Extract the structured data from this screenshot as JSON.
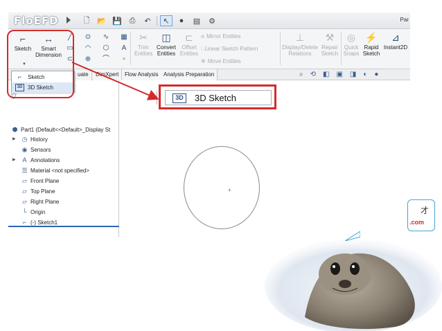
{
  "app": {
    "logo_text": "FloEFD",
    "title_fragment": "Par"
  },
  "ribbon": {
    "sketch_label": "Sketch",
    "smart_dimension_label": "Smart Dimension",
    "trim_entities_label": "Trim Entities",
    "convert_entities_label": "Convert Entities",
    "offset_entities_label": "Offset Entities",
    "mirror_entities_label": "Mirror Entities",
    "linear_sketch_pattern_label": "Linear Sketch Pattern",
    "move_entities_label": "Move Entities",
    "display_delete_relations_label": "Display/Delete Relations",
    "repair_sketch_label": "Repair Sketch",
    "quick_snaps_label": "Quick Snaps",
    "rapid_sketch_label": "Rapid Sketch",
    "instant2d_label": "Instant2D"
  },
  "tabs": [
    "uate",
    "DimXpert",
    "Flow Analysis",
    "Analysis Preparation"
  ],
  "sketch_menu": {
    "items": [
      {
        "label": "Sketch",
        "icon": "sketch-icon"
      },
      {
        "label": "3D Sketch",
        "icon": "3d-sketch-icon"
      }
    ]
  },
  "callout": {
    "icon_text": "3D",
    "label": "3D Sketch"
  },
  "tree": {
    "items": [
      {
        "label": "Part1  (Default<<Default>_Display St",
        "icon": "part-icon"
      },
      {
        "label": "History",
        "icon": "history-icon"
      },
      {
        "label": "Sensors",
        "icon": "sensors-icon"
      },
      {
        "label": "Annotations",
        "icon": "annotations-icon"
      },
      {
        "label": "Material <not specified>",
        "icon": "material-icon"
      },
      {
        "label": "Front Plane",
        "icon": "plane-icon"
      },
      {
        "label": "Top Plane",
        "icon": "plane-icon"
      },
      {
        "label": "Right Plane",
        "icon": "plane-icon"
      },
      {
        "label": "Origin",
        "icon": "origin-icon"
      },
      {
        "label": "(-) Sketch1",
        "icon": "sketch-icon"
      }
    ]
  },
  "bubble": {
    "char": "才",
    "domain": ".com"
  },
  "colors": {
    "highlight_red": "#d42a2a",
    "accent_blue": "#2b64b5"
  }
}
